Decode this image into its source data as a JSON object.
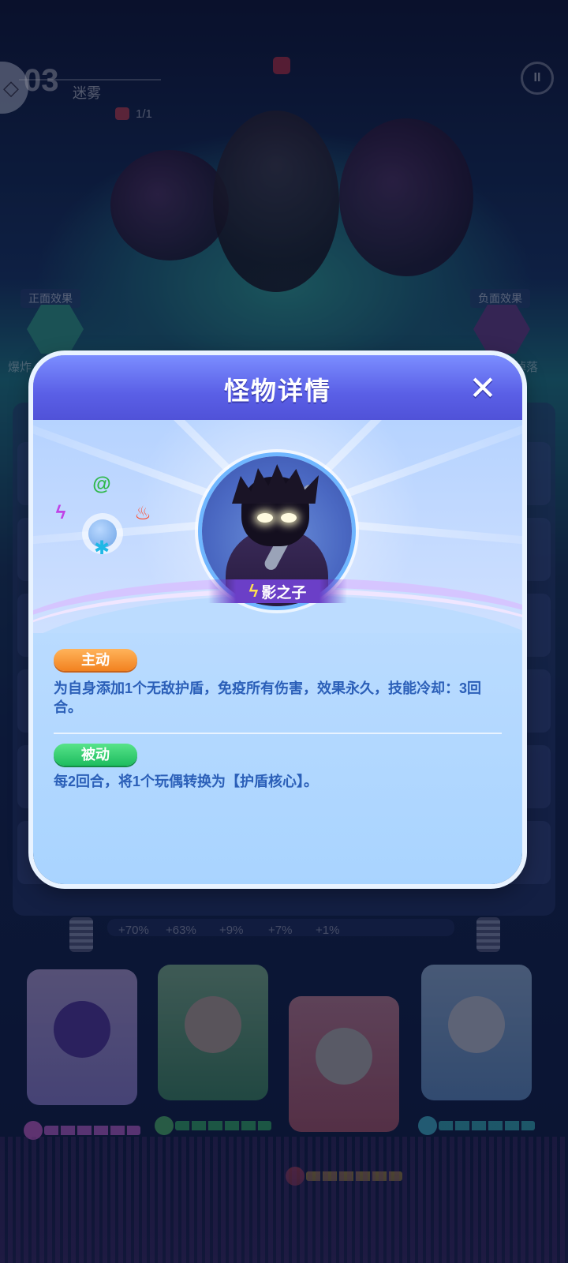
{
  "hud": {
    "level": "03",
    "stage_name": "迷雾",
    "enemy_count": "1/1"
  },
  "effects": {
    "positive_label": "正面效果",
    "negative_label": "负面效果",
    "positive_sub": "爆炸",
    "negative_sub": "掉落"
  },
  "team_stats": [
    "+70%",
    "+63%",
    "+9%",
    "+7%",
    "+1%"
  ],
  "modal": {
    "title": "怪物详情",
    "close_label": "✕",
    "monster_name": "影之子",
    "element_icons": {
      "top": "wind-swirl-icon",
      "left": "lightning-icon",
      "right": "fire-icon",
      "bottom": "ice-icon"
    },
    "skills": {
      "active_label": "主动",
      "active_desc": "为自身添加1个无敌护盾，免疫所有伤害，效果永久，技能冷却：3回合。",
      "passive_label": "被动",
      "passive_desc": "每2回合，将1个玩偶转换为【护盾核心】。"
    }
  },
  "colors": {
    "header": "#5a5fe6",
    "skill_text": "#2b5fb8",
    "active_tag": "#f28220",
    "passive_tag": "#1ebd5f"
  }
}
